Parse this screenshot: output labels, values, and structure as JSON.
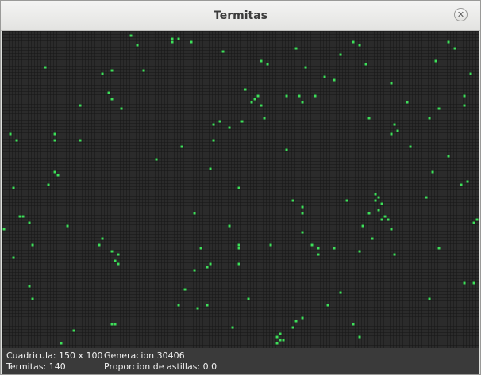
{
  "window": {
    "title": "Termitas",
    "close_icon": "close-icon"
  },
  "grid": {
    "cell_color": "#2b2b2b",
    "line_color": "#161616",
    "termite_color": "#3ee05a",
    "cells": [
      [
        40,
        1
      ],
      [
        53,
        2
      ],
      [
        55,
        2
      ],
      [
        53,
        3
      ],
      [
        42,
        4
      ],
      [
        59,
        3
      ],
      [
        69,
        6
      ],
      [
        81,
        9
      ],
      [
        92,
        5
      ],
      [
        106,
        7
      ],
      [
        110,
        3
      ],
      [
        112,
        4
      ],
      [
        114,
        10
      ],
      [
        136,
        9
      ],
      [
        140,
        3
      ],
      [
        142,
        5
      ],
      [
        147,
        13
      ],
      [
        13,
        11
      ],
      [
        31,
        13
      ],
      [
        34,
        12
      ],
      [
        44,
        12
      ],
      [
        83,
        10
      ],
      [
        95,
        11
      ],
      [
        101,
        14
      ],
      [
        104,
        15
      ],
      [
        76,
        18
      ],
      [
        79,
        21
      ],
      [
        80,
        20
      ],
      [
        78,
        22
      ],
      [
        81,
        23
      ],
      [
        89,
        20
      ],
      [
        93,
        20
      ],
      [
        94,
        22
      ],
      [
        98,
        20
      ],
      [
        122,
        16
      ],
      [
        127,
        22
      ],
      [
        137,
        24
      ],
      [
        145,
        20
      ],
      [
        145,
        23
      ],
      [
        33,
        19
      ],
      [
        34,
        21
      ],
      [
        37,
        24
      ],
      [
        24,
        23
      ],
      [
        2,
        32
      ],
      [
        4,
        34
      ],
      [
        16,
        32
      ],
      [
        16,
        34
      ],
      [
        24,
        34
      ],
      [
        66,
        29
      ],
      [
        68,
        28
      ],
      [
        75,
        28
      ],
      [
        71,
        30
      ],
      [
        82,
        27
      ],
      [
        115,
        27
      ],
      [
        123,
        29
      ],
      [
        124,
        31
      ],
      [
        134,
        27
      ],
      [
        122,
        32
      ],
      [
        56,
        36
      ],
      [
        66,
        34
      ],
      [
        89,
        37
      ],
      [
        128,
        36
      ],
      [
        140,
        39
      ],
      [
        48,
        40
      ],
      [
        16,
        44
      ],
      [
        17,
        45
      ],
      [
        14,
        48
      ],
      [
        3,
        49
      ],
      [
        65,
        43
      ],
      [
        74,
        49
      ],
      [
        91,
        53
      ],
      [
        94,
        55
      ],
      [
        117,
        53
      ],
      [
        135,
        44
      ],
      [
        144,
        48
      ],
      [
        146,
        47
      ],
      [
        133,
        52
      ],
      [
        108,
        53
      ],
      [
        117,
        51
      ],
      [
        118,
        52
      ],
      [
        119,
        54
      ],
      [
        118,
        56
      ],
      [
        120,
        58
      ],
      [
        119,
        59
      ],
      [
        121,
        59
      ],
      [
        122,
        62
      ],
      [
        115,
        57
      ],
      [
        60,
        57
      ],
      [
        5,
        58
      ],
      [
        6,
        58
      ],
      [
        8,
        60
      ],
      [
        20,
        61
      ],
      [
        71,
        61
      ],
      [
        94,
        57
      ],
      [
        113,
        61
      ],
      [
        94,
        63
      ],
      [
        31,
        65
      ],
      [
        9,
        67
      ],
      [
        30,
        67
      ],
      [
        34,
        69
      ],
      [
        36,
        70
      ],
      [
        74,
        67
      ],
      [
        84,
        67
      ],
      [
        74,
        68
      ],
      [
        62,
        68
      ],
      [
        65,
        73
      ],
      [
        97,
        67
      ],
      [
        99,
        68
      ],
      [
        104,
        68
      ],
      [
        116,
        65
      ],
      [
        123,
        70
      ],
      [
        137,
        68
      ],
      [
        149,
        59
      ],
      [
        99,
        70
      ],
      [
        35,
        72
      ],
      [
        36,
        73
      ],
      [
        64,
        74
      ],
      [
        60,
        75
      ],
      [
        74,
        73
      ],
      [
        112,
        69
      ],
      [
        145,
        79
      ],
      [
        148,
        79
      ],
      [
        8,
        80
      ],
      [
        9,
        84
      ],
      [
        57,
        81
      ],
      [
        77,
        84
      ],
      [
        64,
        86
      ],
      [
        55,
        86
      ],
      [
        61,
        87
      ],
      [
        102,
        86
      ],
      [
        106,
        82
      ],
      [
        134,
        84
      ],
      [
        22,
        94
      ],
      [
        34,
        92
      ],
      [
        35,
        92
      ],
      [
        72,
        93
      ],
      [
        92,
        91
      ],
      [
        91,
        93
      ],
      [
        87,
        95
      ],
      [
        110,
        92
      ],
      [
        18,
        98
      ],
      [
        86,
        96
      ],
      [
        87,
        97
      ],
      [
        88,
        97
      ],
      [
        86,
        98
      ],
      [
        94,
        90
      ],
      [
        112,
        96
      ],
      [
        0,
        62
      ],
      [
        3,
        71
      ],
      [
        148,
        60
      ],
      [
        150,
        21
      ]
    ]
  },
  "status": {
    "grid_size": "Cuadricula: 150 x 100",
    "generation": "Generacion 30406",
    "termites": "Termitas: 140",
    "chips_ratio": "Proporcion de astillas: 0.0"
  }
}
